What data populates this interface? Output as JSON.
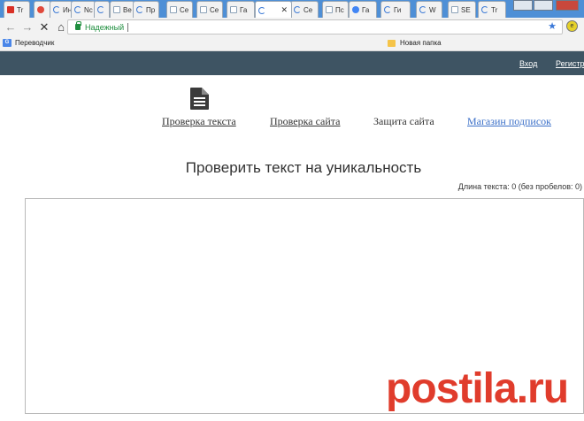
{
  "browser": {
    "tabs": [
      {
        "label": "Tr",
        "icon": "mail-icon"
      },
      {
        "label": "",
        "icon": "chrome-icon"
      },
      {
        "label": "Ин",
        "icon": "loading-icon"
      },
      {
        "label": "Nc",
        "icon": "loading-icon"
      },
      {
        "label": "",
        "icon": "loading-icon"
      },
      {
        "label": "Ве",
        "icon": "page-icon"
      },
      {
        "label": "Пр",
        "icon": "loading-icon"
      },
      {
        "label": "Се",
        "icon": "page-icon"
      },
      {
        "label": "Се",
        "icon": "page-icon"
      },
      {
        "label": "Га",
        "icon": "page-icon"
      },
      {
        "label": "",
        "icon": "loading-icon",
        "close": "✕",
        "active": true
      },
      {
        "label": "Се",
        "icon": "loading-icon"
      },
      {
        "label": "Пс",
        "icon": "page-icon"
      },
      {
        "label": "Га",
        "icon": "google-icon"
      },
      {
        "label": "Ги",
        "icon": "loading-icon"
      },
      {
        "label": "W",
        "icon": "loading-icon"
      },
      {
        "label": "SE",
        "icon": "page-icon"
      },
      {
        "label": "Tr",
        "icon": "loading-icon"
      }
    ],
    "address_bar": {
      "secure_label": "Надежный",
      "url": "",
      "star_glyph": "★"
    },
    "nav": {
      "back": "←",
      "forward": "→",
      "stop": "✕",
      "home": "⌂"
    },
    "extension_badge": "e",
    "bookmarks": [
      {
        "label": "Переводчик",
        "icon": "translate-icon"
      },
      {
        "label": "Новая папка",
        "icon": "folder-icon"
      }
    ]
  },
  "site": {
    "header": {
      "login": "Вход",
      "register": "Регистр"
    },
    "nav_links": [
      {
        "label": "Проверка текста"
      },
      {
        "label": "Проверка сайта"
      },
      {
        "label": "Защита сайта"
      },
      {
        "label": "Магазин подписок"
      }
    ],
    "heading": "Проверить текст на уникальность",
    "length_text": "Длина текста: 0 (без пробелов: 0)",
    "textarea_value": ""
  },
  "watermark": "postila.ru",
  "colors": {
    "header_bg": "#3e5463",
    "secure_green": "#1e8e3e",
    "link_blue": "#3a6fc8",
    "watermark_red": "#e03c2c"
  }
}
